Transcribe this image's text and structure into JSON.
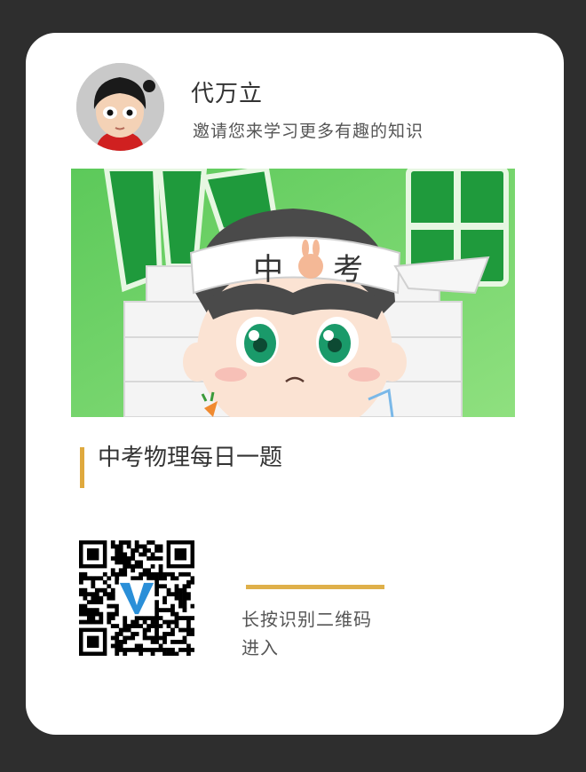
{
  "user": {
    "name": "代万立",
    "invite_text": "邀请您来学习更多有趣的知识",
    "avatar_icon": "cartoon-avatar"
  },
  "banner": {
    "headband_text": "中考",
    "background_color": "#6fd468"
  },
  "course": {
    "title": "中考物理每日一题",
    "accent_color": "#dfa93e"
  },
  "qr": {
    "hint_line1": "长按识别二维码",
    "hint_line2": "进入",
    "logo_icon": "v-logo-icon"
  }
}
